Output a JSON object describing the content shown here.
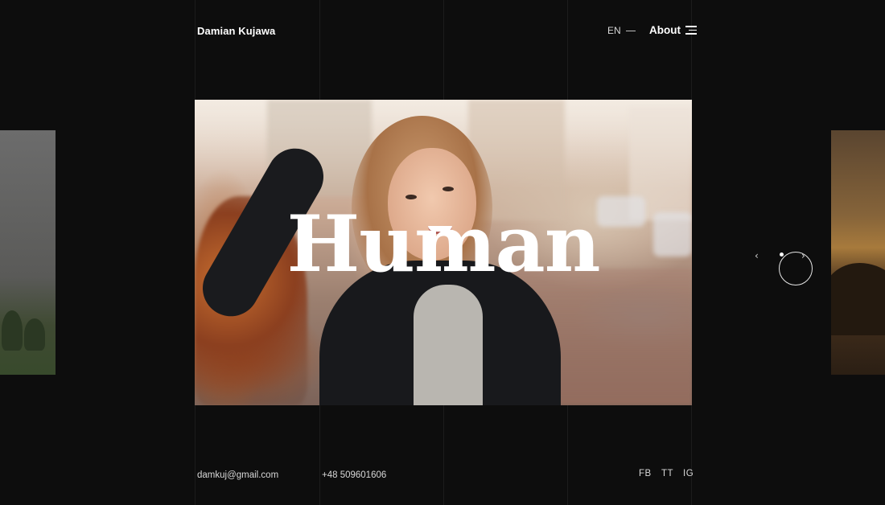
{
  "header": {
    "brand": "Damian Kujawa",
    "language": "EN",
    "about_label": "About"
  },
  "slide": {
    "title": "Human"
  },
  "footer": {
    "email": "damkuj@gmail.com",
    "phone": "+48 509601606",
    "social": [
      "FB",
      "TT",
      "IG"
    ]
  },
  "icons": {
    "menu": "menu-icon",
    "prev": "chevron-left-icon",
    "next": "chevron-right-icon",
    "prev_glyph": "‹",
    "next_glyph": "›"
  },
  "colors": {
    "background": "#0d0d0d",
    "text": "#ffffff",
    "muted_text": "#d8d8d8",
    "grid_line": "#1c1c1c"
  }
}
